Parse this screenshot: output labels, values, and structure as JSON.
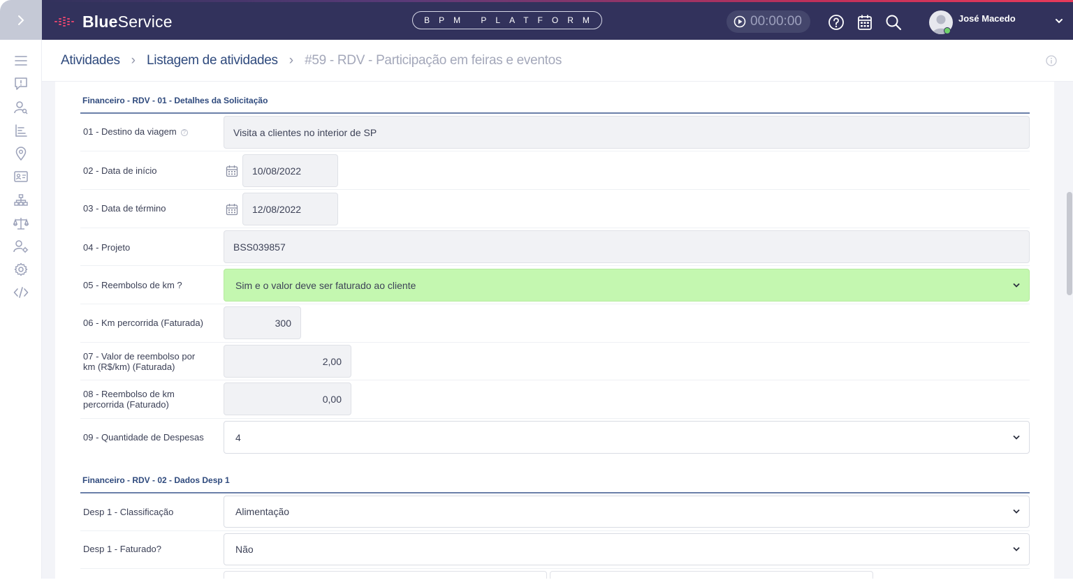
{
  "app": {
    "brand_bold": "Blue",
    "brand_light": "Service",
    "platform_label": "BPM PLATFORM",
    "timer": "00:00:00",
    "user_name": "José Macedo",
    "colors": {
      "topbar": "#32325c",
      "accent_green": "#c4f7b0",
      "link": "#2f4a7d"
    }
  },
  "breadcrumb": {
    "items": [
      "Atividades",
      "Listagem de atividades"
    ],
    "current": "#59 - RDV - Participação em feiras e eventos"
  },
  "sections": [
    {
      "title": "Financeiro - RDV - 01 - Detalhes da Solicitação",
      "fields": [
        {
          "label": "01 - Destino da viagem",
          "value": "Visita a clientes no interior de SP"
        },
        {
          "label": "02 - Data de início",
          "value": "10/08/2022"
        },
        {
          "label": "03 - Data de término",
          "value": "12/08/2022"
        },
        {
          "label": "04 - Projeto",
          "value": "BSS039857"
        },
        {
          "label": "05 - Reembolso de km ?",
          "value": "Sim e o valor deve ser faturado ao cliente"
        },
        {
          "label": "06 - Km percorrida (Faturada)",
          "value": "300"
        },
        {
          "label_line1": "07 - Valor de reembolso por",
          "label_line2": "km (R$/km) (Faturada)",
          "value": "2,00"
        },
        {
          "label_line1": "08 - Reembolso de km",
          "label_line2": "percorrida (Faturado)",
          "value": "0,00"
        },
        {
          "label": "09 - Quantidade de Despesas",
          "value": "4"
        }
      ]
    },
    {
      "title": "Financeiro - RDV - 02 - Dados Desp 1",
      "fields": [
        {
          "label": "Desp 1 - Classificação",
          "value": "Alimentação"
        },
        {
          "label": "Desp 1 - Faturado?",
          "value": "Não"
        }
      ]
    }
  ],
  "icons": {
    "sidebar": [
      "menu-icon",
      "alert-icon",
      "user-search-icon",
      "list-chart-icon",
      "location-icon",
      "id-card-icon",
      "org-chart-icon",
      "scale-icon",
      "user-gear-icon",
      "settings-icon",
      "code-icon"
    ],
    "topbar": [
      "play-icon",
      "help-icon",
      "calendar-icon",
      "search-icon",
      "chevron-down-icon"
    ]
  }
}
